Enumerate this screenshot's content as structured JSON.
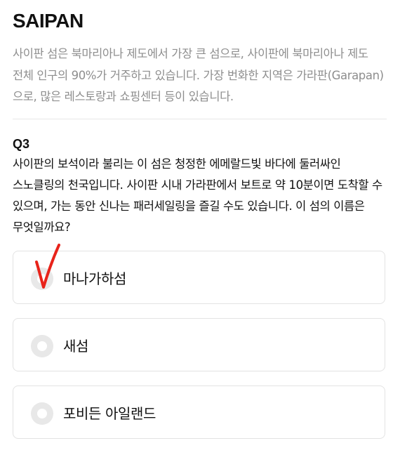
{
  "header": {
    "title": "SAIPAN"
  },
  "intro": {
    "text": "사이판 섬은 북마리아나 제도에서 가장 큰 섬으로, 사이판에 북마리아나 제도 전체 인구의 90%가 거주하고 있습니다. 가장 번화한 지역은 가라판(Garapan)으로, 많은 레스토랑과 쇼핑센터 등이 있습니다."
  },
  "question": {
    "number": "Q3",
    "text": "사이판의 보석이라 불리는 이 섬은 청정한 에메랄드빛 바다에 둘러싸인 스노클링의 천국입니다. 사이판 시내 가라판에서 보트로 약 10분이면 도착할 수 있으며, 가는 동안 신나는 패러세일링을 즐길 수도 있습니다. 이 섬의 이름은 무엇일까요?"
  },
  "options": [
    {
      "label": "마나가하섬",
      "selected": false
    },
    {
      "label": "새섬",
      "selected": false
    },
    {
      "label": "포비든 아일랜드",
      "selected": false
    }
  ],
  "annotation": {
    "icon": "handwritten-checkmark-icon",
    "color": "#e8231a"
  }
}
